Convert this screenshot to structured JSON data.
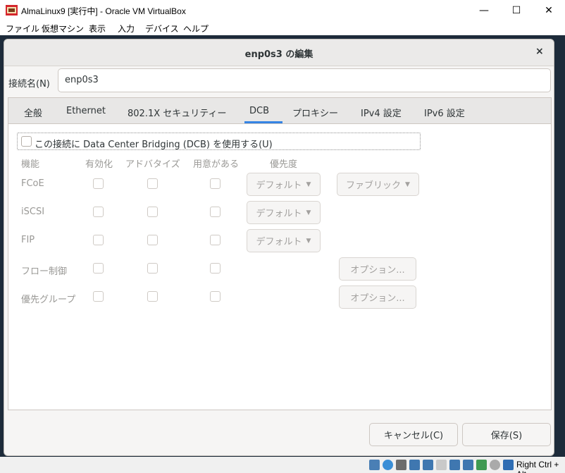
{
  "window": {
    "title": "AlmaLinux9 [実行中] - Oracle VM VirtualBox",
    "minimize": "—",
    "maximize": "☐",
    "close": "✕"
  },
  "host_menu": [
    "ファイル",
    "仮想マシン",
    "表示",
    "入力",
    "デバイス",
    "ヘルプ"
  ],
  "dialog": {
    "title": "enp0s3 の編集",
    "close": "×",
    "connection_name_label": "接続名(N)",
    "connection_name_value": "enp0s3"
  },
  "tabs": [
    "全般",
    "Ethernet",
    "802.1X セキュリティー",
    "DCB",
    "プロキシー",
    "IPv4 設定",
    "IPv6 設定"
  ],
  "active_tab": "DCB",
  "dcb": {
    "enable_label": "この接続に Data Center Bridging (DCB) を使用する(U)",
    "enabled": false,
    "headers": [
      "機能",
      "有効化",
      "アドバタイズ",
      "用意がある",
      "優先度"
    ],
    "rows": [
      {
        "name": "FCoE",
        "priority": "デフォルト",
        "extra": "ファブリック"
      },
      {
        "name": "iSCSI",
        "priority": "デフォルト"
      },
      {
        "name": "FIP",
        "priority": "デフォルト"
      },
      {
        "name": "フロー制御",
        "extra": "オプション..."
      },
      {
        "name": "優先グループ",
        "extra": "オプション..."
      }
    ]
  },
  "buttons": {
    "cancel": "キャンセル(C)",
    "save": "保存(S)"
  },
  "statusbar": {
    "host_key": "Right Ctrl + Alt"
  },
  "colors": {
    "accent": "#3584e4",
    "dim_text": "#9a9996"
  }
}
